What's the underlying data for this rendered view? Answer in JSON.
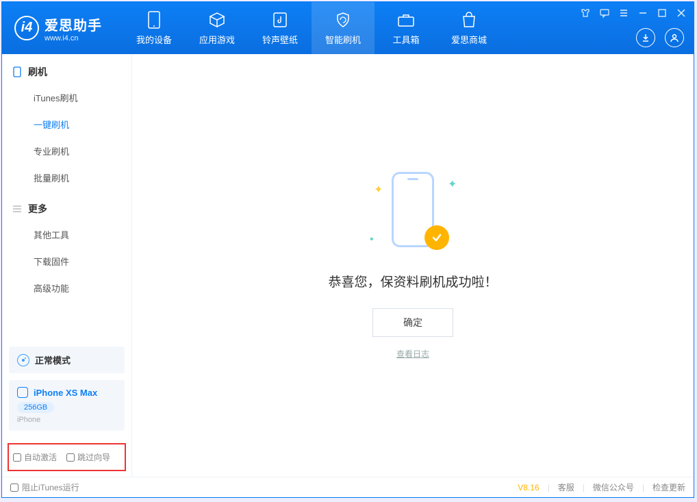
{
  "app": {
    "name": "爱思助手",
    "url": "www.i4.cn"
  },
  "tabs": [
    {
      "label": "我的设备"
    },
    {
      "label": "应用游戏"
    },
    {
      "label": "铃声壁纸"
    },
    {
      "label": "智能刷机"
    },
    {
      "label": "工具箱"
    },
    {
      "label": "爱思商城"
    }
  ],
  "sidebar": {
    "group1_title": "刷机",
    "group1_items": [
      "iTunes刷机",
      "一键刷机",
      "专业刷机",
      "批量刷机"
    ],
    "group2_title": "更多",
    "group2_items": [
      "其他工具",
      "下载固件",
      "高级功能"
    ]
  },
  "mode": {
    "label": "正常模式"
  },
  "device": {
    "name": "iPhone XS Max",
    "storage": "256GB",
    "type": "iPhone"
  },
  "checks": {
    "auto_activate": "自动激活",
    "skip_guide": "跳过向导"
  },
  "main": {
    "success": "恭喜您，保资料刷机成功啦！",
    "ok": "确定",
    "view_log": "查看日志"
  },
  "footer": {
    "block_itunes": "阻止iTunes运行",
    "version": "V8.16",
    "links": [
      "客服",
      "微信公众号",
      "检查更新"
    ]
  }
}
